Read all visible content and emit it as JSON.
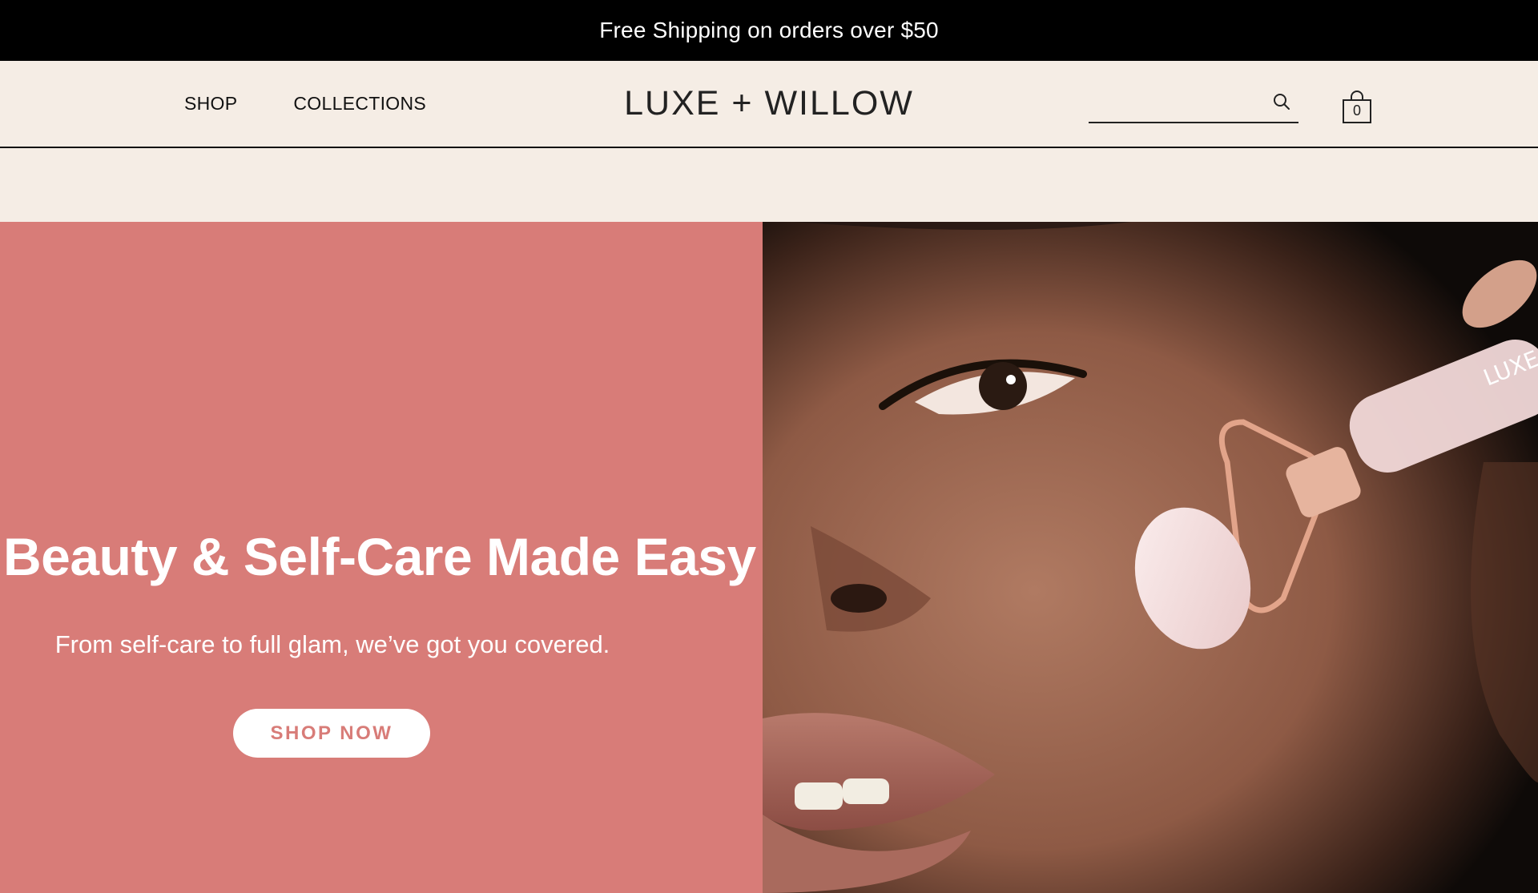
{
  "announcement": {
    "text": "Free Shipping on orders over $50"
  },
  "nav": {
    "items": [
      {
        "label": "SHOP"
      },
      {
        "label": "COLLECTIONS"
      }
    ]
  },
  "brand": {
    "name": "LUXE + WILLOW"
  },
  "search": {
    "placeholder": ""
  },
  "cart": {
    "count": "0"
  },
  "hero": {
    "title": "Beauty & Self-Care Made Easy",
    "subtitle": "From self-care to full glam, we’ve got you covered.",
    "cta_label": "SHOP NOW",
    "image_logo_text": "LUXE"
  },
  "colors": {
    "hero_bg": "#d87c78",
    "header_bg": "#f5ede5",
    "announcement_bg": "#000000"
  },
  "icons": {
    "search": "search-icon",
    "cart": "shopping-bag-icon"
  }
}
